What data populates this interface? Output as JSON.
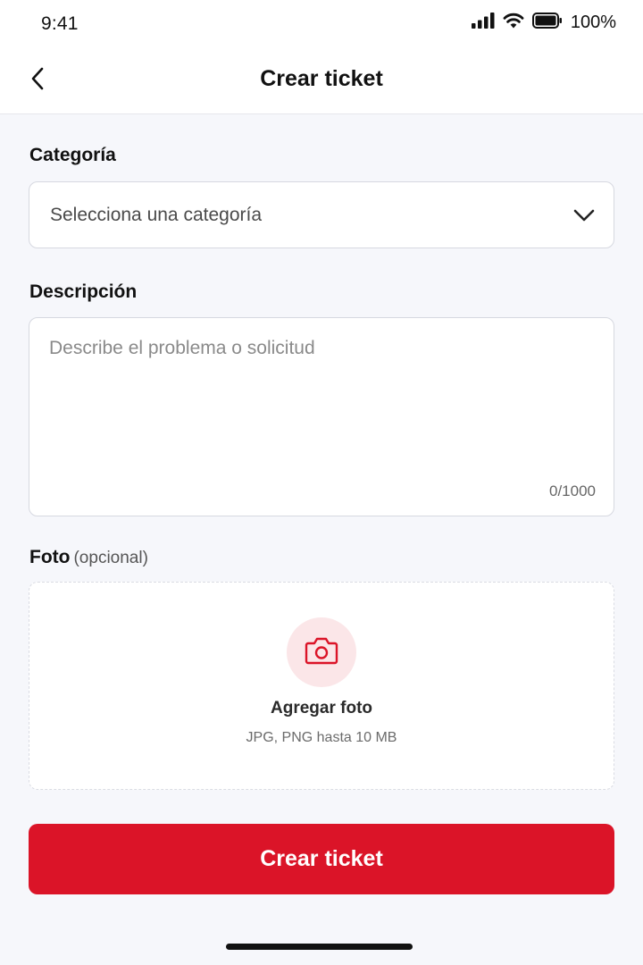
{
  "status_bar": {
    "time": "9:41",
    "battery_percent": "100%",
    "icons": [
      "signal-icon",
      "wifi-icon",
      "battery-icon"
    ]
  },
  "header": {
    "title": "Crear ticket",
    "back_icon": "chevron-left-icon"
  },
  "form": {
    "category": {
      "label": "Categoría",
      "placeholder": "Selecciona una categoría",
      "icon": "chevron-down-icon"
    },
    "description": {
      "label": "Descripción",
      "placeholder": "Describe el problema o solicitud",
      "value": "",
      "counter": "0/1000"
    },
    "photo": {
      "label": "Foto",
      "optional_label": "(opcional)",
      "upload_title": "Agregar foto",
      "upload_hint": "JPG, PNG hasta 10 MB",
      "icon": "camera-icon"
    },
    "submit_label": "Crear ticket"
  },
  "colors": {
    "accent": "#db1428",
    "accent_soft": "#fbe6e8",
    "background": "#f6f7fb"
  }
}
